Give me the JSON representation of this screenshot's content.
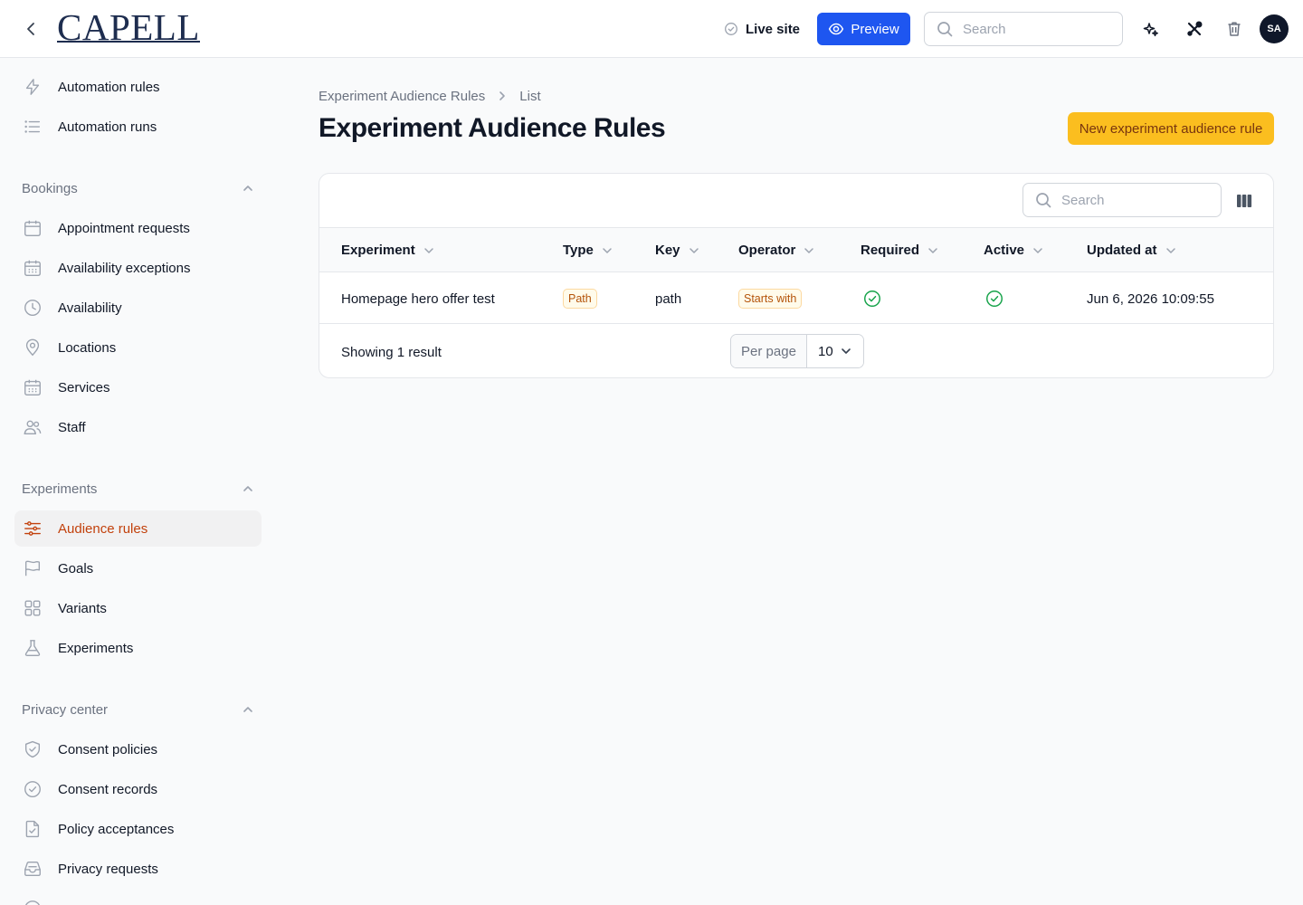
{
  "header": {
    "logo_text": "CAPELL",
    "live_site_label": "Live site",
    "preview_label": "Preview",
    "search_placeholder": "Search",
    "avatar_initials": "SA"
  },
  "sidebar": {
    "top_items": [
      {
        "label": "Automation rules",
        "icon": "bolt-icon"
      },
      {
        "label": "Automation runs",
        "icon": "list-icon"
      }
    ],
    "groups": [
      {
        "label": "Bookings",
        "items": [
          {
            "label": "Appointment requests",
            "icon": "calendar-icon"
          },
          {
            "label": "Availability exceptions",
            "icon": "calendar-days-icon"
          },
          {
            "label": "Availability",
            "icon": "clock-icon"
          },
          {
            "label": "Locations",
            "icon": "map-pin-icon"
          },
          {
            "label": "Services",
            "icon": "calendar-days-icon"
          },
          {
            "label": "Staff",
            "icon": "users-icon"
          }
        ]
      },
      {
        "label": "Experiments",
        "items": [
          {
            "label": "Audience rules",
            "icon": "sliders-icon",
            "active": true
          },
          {
            "label": "Goals",
            "icon": "flag-icon"
          },
          {
            "label": "Variants",
            "icon": "grid-icon"
          },
          {
            "label": "Experiments",
            "icon": "beaker-icon"
          }
        ]
      },
      {
        "label": "Privacy center",
        "items": [
          {
            "label": "Consent policies",
            "icon": "shield-check-icon"
          },
          {
            "label": "Consent records",
            "icon": "check-circle-icon"
          },
          {
            "label": "Policy acceptances",
            "icon": "document-check-icon"
          },
          {
            "label": "Privacy requests",
            "icon": "inbox-icon"
          }
        ]
      }
    ]
  },
  "page": {
    "breadcrumb": [
      "Experiment Audience Rules",
      "List"
    ],
    "title": "Experiment Audience Rules",
    "new_button_label": "New experiment audience rule"
  },
  "table": {
    "search_placeholder": "Search",
    "columns": [
      "Experiment",
      "Type",
      "Key",
      "Operator",
      "Required",
      "Active",
      "Updated at"
    ],
    "rows": [
      {
        "experiment": "Homepage hero offer test",
        "type": "Path",
        "key": "path",
        "operator": "Starts with",
        "required": true,
        "active": true,
        "updated_at": "Jun 6, 2026 10:09:55"
      }
    ],
    "summary": "Showing 1 result",
    "per_page_label": "Per page",
    "per_page_value": "10"
  },
  "colors": {
    "primary": "#1e56f0",
    "accent": "#fbbe1f",
    "active_nav_text": "#c2410c",
    "success": "#16a34a"
  }
}
